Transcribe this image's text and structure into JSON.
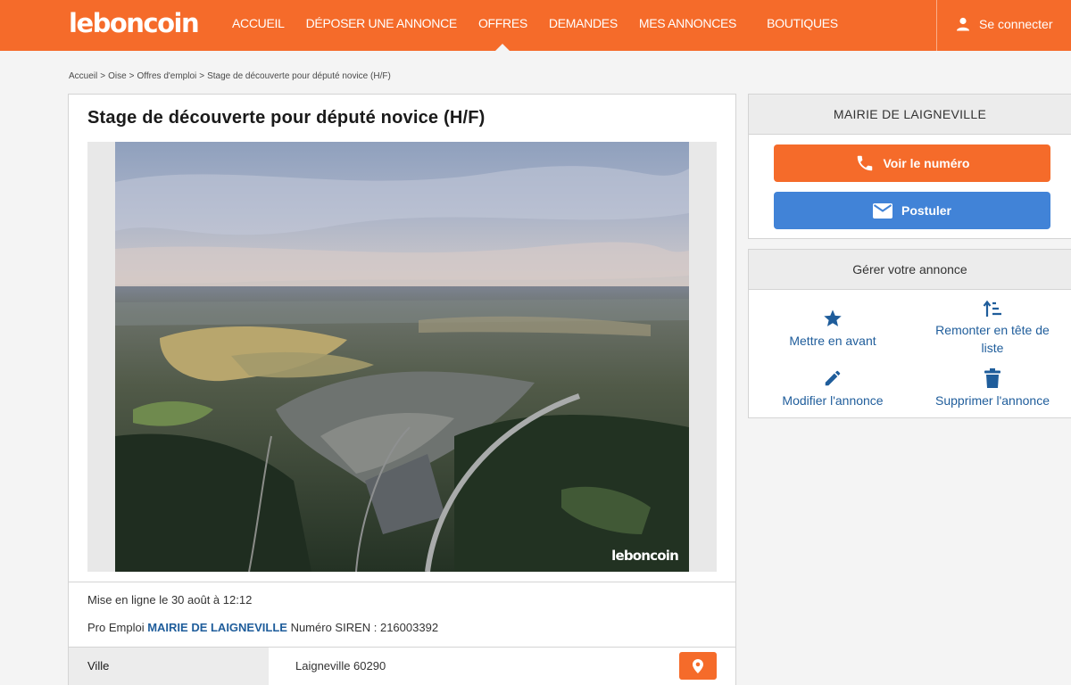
{
  "header": {
    "logo": "leboncoin",
    "nav": [
      {
        "label": "ACCUEIL"
      },
      {
        "label": "DÉPOSER UNE ANNONCE"
      },
      {
        "label": "OFFRES"
      },
      {
        "label": "DEMANDES"
      },
      {
        "label": "MES ANNONCES"
      },
      {
        "label": "BOUTIQUES"
      }
    ],
    "active_nav": "OFFRES",
    "login_label": "Se connecter"
  },
  "breadcrumb": [
    "Accueil",
    "Oise",
    "Offres d'emploi",
    "Stage de découverte pour député novice (H/F)"
  ],
  "ad": {
    "title": "Stage de découverte pour député novice (H/F)",
    "watermark": "leboncoin",
    "posted": "Mise en ligne le 30 août à 12:12",
    "pro_prefix": "Pro Emploi",
    "pro_name": "MAIRIE DE LAIGNEVILLE",
    "siren": "Numéro SIREN : 216003392",
    "attributes": [
      {
        "label": "Ville",
        "value": "Laigneville 60290"
      }
    ]
  },
  "contact": {
    "name": "MAIRIE DE LAIGNEVILLE",
    "call_label": "Voir le numéro",
    "apply_label": "Postuler"
  },
  "manage": {
    "title": "Gérer votre annonce",
    "actions": [
      {
        "label": "Mettre en avant",
        "icon": "star-icon"
      },
      {
        "label": "Remonter en tête de liste",
        "icon": "sort-icon"
      },
      {
        "label": "Modifier l'annonce",
        "icon": "pencil-icon"
      },
      {
        "label": "Supprimer l'annonce",
        "icon": "trash-icon"
      }
    ]
  },
  "colors": {
    "brand": "#f56b2a",
    "button_blue": "#4183d7",
    "link_blue": "#1f5d9b",
    "background": "#f4f4f4"
  }
}
